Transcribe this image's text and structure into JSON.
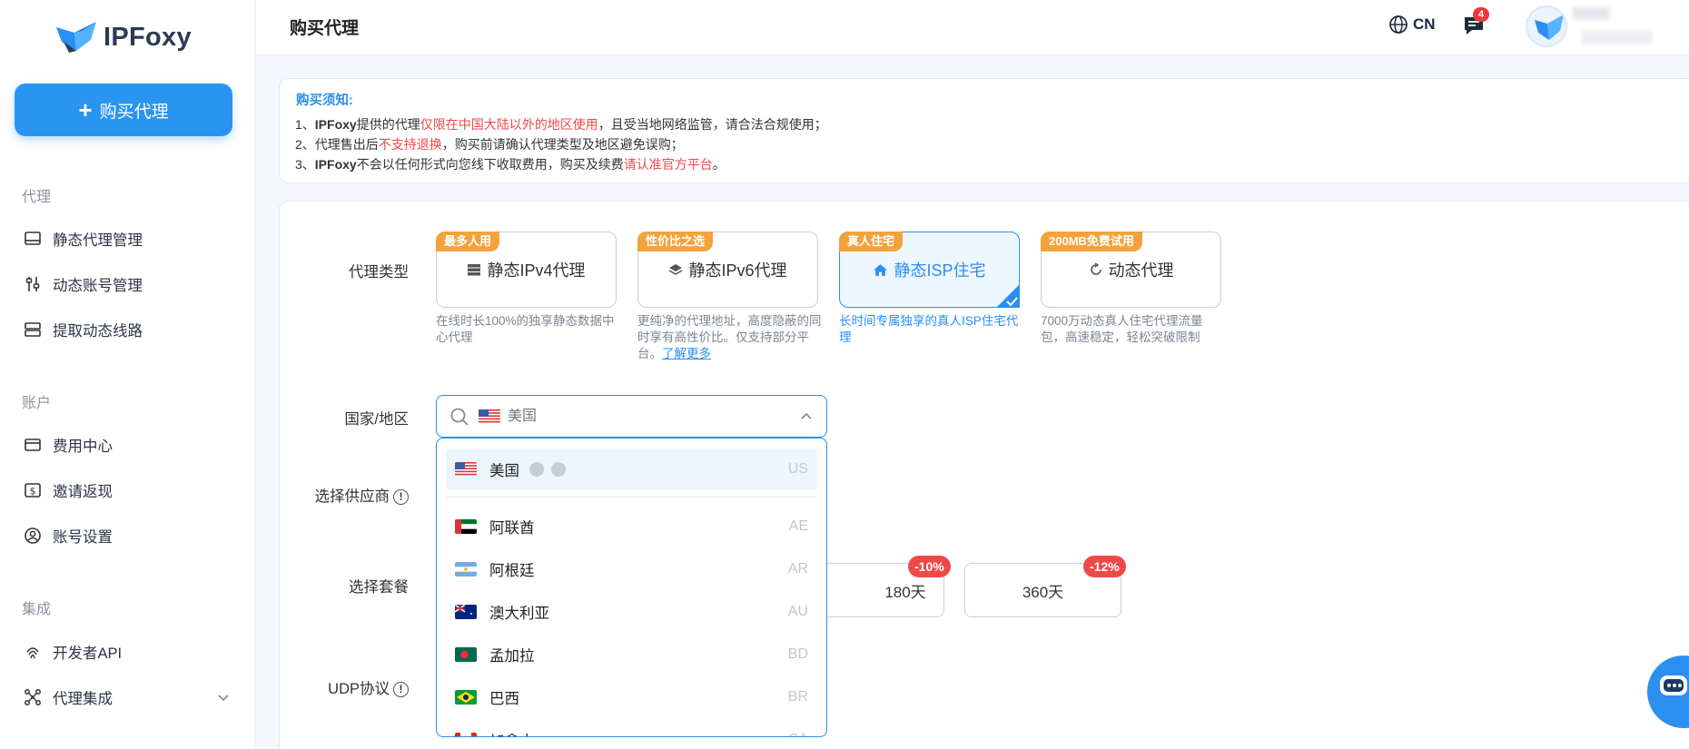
{
  "app": {
    "name": "IPFoxy"
  },
  "sidebar": {
    "buy_label": "购买代理",
    "sections": [
      {
        "title": "代理",
        "items": [
          {
            "label": "静态代理管理",
            "icon": "monitor-icon"
          },
          {
            "label": "动态账号管理",
            "icon": "sliders-icon"
          },
          {
            "label": "提取动态线路",
            "icon": "server-icon"
          }
        ]
      },
      {
        "title": "账户",
        "items": [
          {
            "label": "费用中心",
            "icon": "card-icon"
          },
          {
            "label": "邀请返现",
            "icon": "dollar-icon"
          },
          {
            "label": "账号设置",
            "icon": "user-icon"
          }
        ]
      },
      {
        "title": "集成",
        "items": [
          {
            "label": "开发者API",
            "icon": "fingerprint-icon"
          },
          {
            "label": "代理集成",
            "icon": "network-icon"
          }
        ]
      }
    ]
  },
  "header": {
    "title": "购买代理",
    "lang": "CN",
    "message_count": "4"
  },
  "notice": {
    "title": "购买须知:",
    "line1": {
      "a": "1、",
      "b": "IPFoxy",
      "c": "提供的代理",
      "red": "仅限在中国大陆以外的地区使用",
      "d": "，且受当地网络监管，请合法合规使用；"
    },
    "line2": {
      "a": "2、代理售出后",
      "red": "不支持退换",
      "d": "，购买前请确认代理类型及地区避免误购；"
    },
    "line3": {
      "a": "3、",
      "b": "IPFoxy",
      "c": "不会以任何形式向您线下收取费用，购买及续费",
      "red": "请认准官方平台",
      "d": "。"
    }
  },
  "form": {
    "type_label": "代理类型",
    "country_label": "国家/地区",
    "supplier_label": "选择供应商",
    "plan_label": "选择套餐",
    "udp_label": "UDP协议"
  },
  "proxy_types": [
    {
      "tag": "最多人用",
      "name": "静态IPv4代理",
      "desc": "在线时长100%的独享静态数据中心代理",
      "active": false
    },
    {
      "tag": "性价比之选",
      "name": "静态IPv6代理",
      "desc": "更纯净的代理地址，高度隐蔽的同时享有高性价比。仅支持部分平台。",
      "link": "了解更多",
      "active": false
    },
    {
      "tag": "真人住宅",
      "name": "静态ISP住宅",
      "desc": "长时间专属独享的真人ISP住宅代理",
      "active": true
    },
    {
      "tag": "200MB免费试用",
      "name": "动态代理",
      "desc": "7000万动态真人住宅代理流量包，高速稳定，轻松突破限制",
      "active": false
    }
  ],
  "country_search": {
    "placeholder": "美国"
  },
  "countries": [
    {
      "name": "美国",
      "code": "US"
    },
    {
      "name": "阿联酋",
      "code": "AE"
    },
    {
      "name": "阿根廷",
      "code": "AR"
    },
    {
      "name": "澳大利亚",
      "code": "AU"
    },
    {
      "name": "孟加拉",
      "code": "BD"
    },
    {
      "name": "巴西",
      "code": "BR"
    },
    {
      "name": "加拿大",
      "code": "CA"
    }
  ],
  "plans": [
    {
      "label": "180天",
      "discount": "-10%"
    },
    {
      "label": "360天",
      "discount": "-12%"
    }
  ],
  "colors": {
    "primary": "#2a8ff0",
    "accent_red": "#f04848",
    "tag_orange": "#f3a23c"
  }
}
